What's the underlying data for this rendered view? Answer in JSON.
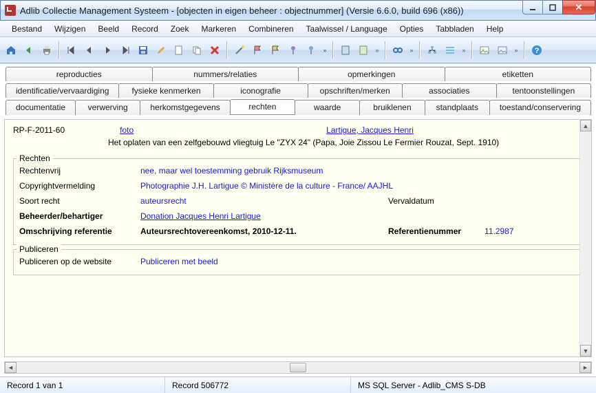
{
  "window": {
    "title": "Adlib Collectie Management Systeem - [objecten in eigen beheer : objectnummer] (Versie 6.6.0, build 696 (x86))"
  },
  "menu": {
    "items": [
      "Bestand",
      "Wijzigen",
      "Beeld",
      "Record",
      "Zoek",
      "Markeren",
      "Combineren",
      "Taalwissel / Language",
      "Opties",
      "Tabbladen",
      "Help"
    ]
  },
  "tabs_row1": [
    "reproducties",
    "nummers/relaties",
    "opmerkingen",
    "etiketten"
  ],
  "tabs_row2": [
    "identificatie/vervaardiging",
    "fysieke kenmerken",
    "iconografie",
    "opschriften/merken",
    "associaties",
    "tentoonstellingen"
  ],
  "tabs_row3": [
    "documentatie",
    "verwerving",
    "herkomstgegevens",
    "rechten",
    "waarde",
    "bruiklenen",
    "standplaats",
    "toestand/conservering"
  ],
  "active_tab": "rechten",
  "record": {
    "object_number": "RP-F-2011-60",
    "object_type": "foto",
    "artist": "Lartigue, Jacques Henri",
    "title": "Het oplaten van een zelfgebouwd vliegtuig Le \"ZYX 24\" (Papa, Joie Zissou Le Fermier Rouzat, Sept. 1910)"
  },
  "rights": {
    "legend": "Rechten",
    "rechtenvrij_label": "Rechtenvrij",
    "rechtenvrij_value": "nee, maar wel toestemming gebruik Rijksmuseum",
    "copyright_label": "Copyrightvermelding",
    "copyright_value": "Photographie J.H. Lartigue © Ministère de la culture - France/ AAJHL",
    "soort_label": "Soort recht",
    "soort_value": "auteursrecht",
    "verval_label": "Vervaldatum",
    "verval_value": "",
    "beheerder_label": "Beheerder/behartiger",
    "beheerder_value": "Donation Jacques Henri Lartigue",
    "omschrijving_label": "Omschrijving referentie",
    "omschrijving_value": "Auteursrechtovereenkomst, 2010-12-11.",
    "refnr_label": "Referentienummer",
    "refnr_value": "11.2987"
  },
  "publish": {
    "legend": "Publiceren",
    "label": "Publiceren op de website",
    "value": "Publiceren met beeld"
  },
  "status": {
    "record_pos": "Record 1 van 1",
    "record_id": "Record 506772",
    "db": "MS SQL Server - Adlib_CMS S-DB"
  }
}
